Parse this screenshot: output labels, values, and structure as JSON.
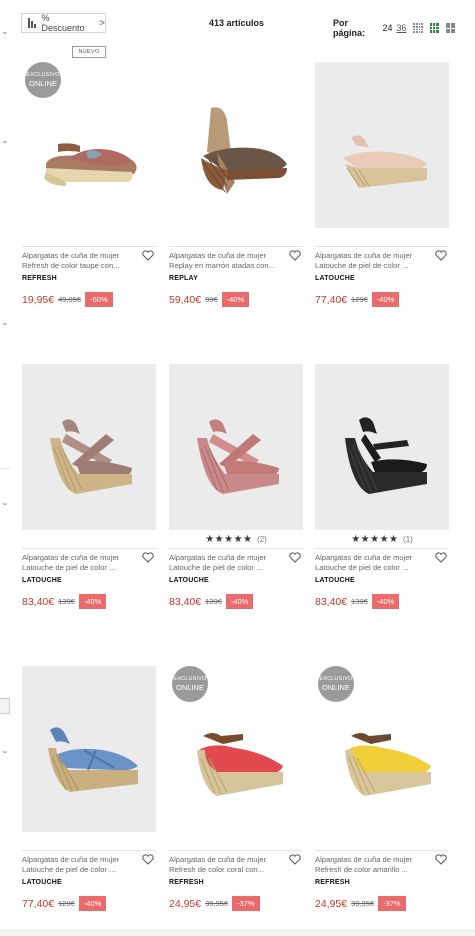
{
  "toolbar": {
    "sort_label": "% Descuento",
    "sort_caret": ">",
    "count_label": "413 artículos",
    "per_page_label": "Por página:",
    "per_page_options": [
      "24",
      "36"
    ]
  },
  "badges": {
    "online_line1": "EXCLUSIVO",
    "online_line2": "ONLINE",
    "new": "NUEVO"
  },
  "colors": {
    "price_red": "#c0392b",
    "discount_bg": "#e96b6b",
    "grid_active": "#2a8a3a"
  },
  "products": [
    {
      "line1": "Alpargatas de cuña de mujer",
      "line2": "Refresh de color taupe con...",
      "brand": "REFRESH",
      "price": "19,95€",
      "old_price": "49,95€",
      "discount": "-60%"
    },
    {
      "line1": "Alpargatas de cuña de mujer",
      "line2": "Replay en marrón atadas con...",
      "brand": "REPLAY",
      "price": "59,40€",
      "old_price": "99€",
      "discount": "-40%"
    },
    {
      "line1": "Alpargatas de cuña de mujer",
      "line2": "Latouche de piel de color ...",
      "brand": "LATOUCHE",
      "price": "77,40€",
      "old_price": "129€",
      "discount": "-40%"
    },
    {
      "line1": "Alpargatas de cuña de mujer",
      "line2": "Latouche de piel de color ...",
      "brand": "LATOUCHE",
      "price": "83,40€",
      "old_price": "139€",
      "discount": "-40%"
    },
    {
      "line1": "Alpargatas de cuña de mujer",
      "line2": "Latouche de piel de color ...",
      "brand": "LATOUCHE",
      "price": "83,40€",
      "old_price": "139€",
      "discount": "-40%",
      "rating_stars": "★★★★★",
      "rating_count": "(2)"
    },
    {
      "line1": "Alpargatas de cuña de mujer",
      "line2": "Latouche de piel de color ...",
      "brand": "LATOUCHE",
      "price": "83,40€",
      "old_price": "139€",
      "discount": "-40%",
      "rating_stars": "★★★★★",
      "rating_count": "(1)"
    },
    {
      "line1": "Alpargatas de cuña de mujer",
      "line2": "Latouche de piel de color ...",
      "brand": "LATOUCHE",
      "price": "77,40€",
      "old_price": "129€",
      "discount": "-40%"
    },
    {
      "line1": "Alpargatas de cuña de mujer",
      "line2": "Refresh de color coral con...",
      "brand": "REFRESH",
      "price": "24,95€",
      "old_price": "39,95€",
      "discount": "-37%"
    },
    {
      "line1": "Alpargatas de cuña de mujer",
      "line2": "Refresh de color amarillo ...",
      "brand": "REFRESH",
      "price": "24,95€",
      "old_price": "39,95€",
      "discount": "-37%"
    }
  ]
}
